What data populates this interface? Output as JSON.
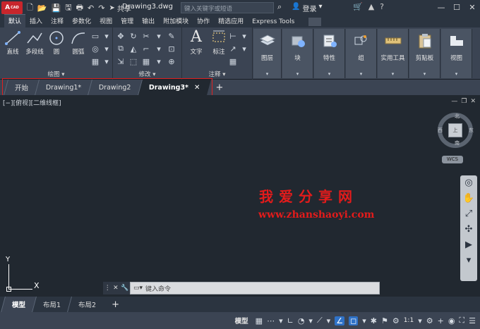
{
  "titlebar": {
    "logo_text": "A",
    "logo_sub": "CAD",
    "share_label": "共享",
    "doc_title": "Drawing3.dwg",
    "search_placeholder": "键入关键字或短语",
    "login_label": "登录",
    "help_icon": "?"
  },
  "ribbon_tabs": [
    {
      "label": "默认",
      "active": true
    },
    {
      "label": "插入"
    },
    {
      "label": "注释"
    },
    {
      "label": "参数化"
    },
    {
      "label": "视图"
    },
    {
      "label": "管理"
    },
    {
      "label": "输出"
    },
    {
      "label": "附加模块"
    },
    {
      "label": "协作"
    },
    {
      "label": "精选应用"
    },
    {
      "label": "Express Tools"
    }
  ],
  "ribbon": {
    "draw": {
      "panel_label": "绘图",
      "tools": [
        "直线",
        "多段线",
        "圆",
        "圆弧"
      ]
    },
    "modify": {
      "panel_label": "修改"
    },
    "annotation": {
      "panel_label": "注释",
      "tools": [
        "文字",
        "标注"
      ]
    },
    "big_buttons": [
      "图层",
      "块",
      "特性",
      "组",
      "实用工具",
      "剪贴板",
      "视图"
    ]
  },
  "doc_tabs": {
    "tabs": [
      {
        "label": "开始"
      },
      {
        "label": "Drawing1*"
      },
      {
        "label": "Drawing2"
      },
      {
        "label": "Drawing3*",
        "active": true
      }
    ],
    "close_glyph": "✕",
    "add_glyph": "+"
  },
  "viewport": {
    "view_label": "[−][俯视][二维线框]",
    "viewcube": {
      "north": "北",
      "south": "南",
      "east": "东",
      "west": "西",
      "face": "上"
    },
    "wcs_label": "WCS",
    "ucs": {
      "x": "X",
      "y": "Y"
    }
  },
  "watermark": {
    "cn": "我爱分享网",
    "url": "www.zhanshaoyi.com"
  },
  "command_line": {
    "placeholder": "键入命令"
  },
  "layout_tabs": {
    "tabs": [
      {
        "label": "模型",
        "active": true
      },
      {
        "label": "布局1"
      },
      {
        "label": "布局2"
      }
    ],
    "add_glyph": "+"
  },
  "statusbar": {
    "model_label": "模型",
    "scale_label": "1:1"
  }
}
